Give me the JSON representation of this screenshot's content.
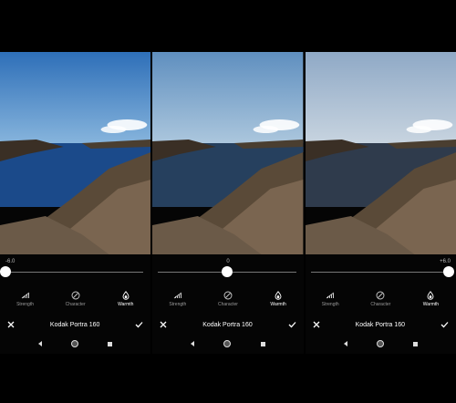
{
  "screens": [
    {
      "slider_value": "-6.0",
      "slider_fraction": 0.0,
      "value_align": "left",
      "tools": [
        {
          "label": "Strength",
          "icon": "strength-bars-icon",
          "active": false
        },
        {
          "label": "Character",
          "icon": "character-circle-icon",
          "active": false
        },
        {
          "label": "Warmth",
          "icon": "warmth-drop-icon",
          "active": true
        }
      ],
      "filter_name": "Kodak Portra 160",
      "tint": "#1b4a8a",
      "sky_top": "#2e6fb8",
      "sky_bottom": "#8fbbe0"
    },
    {
      "slider_value": "0",
      "slider_fraction": 0.5,
      "value_align": "center",
      "tools": [
        {
          "label": "Strength",
          "icon": "strength-bars-icon",
          "active": false
        },
        {
          "label": "Character",
          "icon": "character-circle-icon",
          "active": false
        },
        {
          "label": "Warmth",
          "icon": "warmth-drop-icon",
          "active": true
        }
      ],
      "filter_name": "Kodak Portra 160",
      "tint": "#26405e",
      "sky_top": "#5f8fbf",
      "sky_bottom": "#b3cce0"
    },
    {
      "slider_value": "+6.0",
      "slider_fraction": 1.0,
      "value_align": "right",
      "tools": [
        {
          "label": "Strength",
          "icon": "strength-bars-icon",
          "active": false
        },
        {
          "label": "Character",
          "icon": "character-circle-icon",
          "active": false
        },
        {
          "label": "Warmth",
          "icon": "warmth-drop-icon",
          "active": true
        }
      ],
      "filter_name": "Kodak Portra 160",
      "tint": "#2f3b4c",
      "sky_top": "#8fa9c6",
      "sky_bottom": "#cdd8e2"
    }
  ]
}
